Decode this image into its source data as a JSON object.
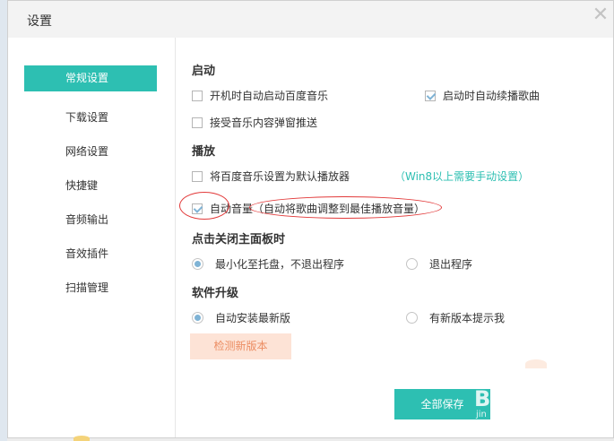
{
  "dialog": {
    "title": "设置",
    "close_glyph": "✕"
  },
  "nav": {
    "items": [
      {
        "label": "常规设置",
        "active": true
      },
      {
        "label": "下载设置"
      },
      {
        "label": "网络设置"
      },
      {
        "label": "快捷键"
      },
      {
        "label": "音频输出"
      },
      {
        "label": "音效插件"
      },
      {
        "label": "扫描管理"
      }
    ]
  },
  "sections": {
    "startup": {
      "title": "启动",
      "auto_start": {
        "label": "开机时自动启动百度音乐",
        "checked": false
      },
      "auto_resume": {
        "label": "启动时自动续播歌曲",
        "checked": true
      },
      "accept_push": {
        "label": "接受音乐内容弹窗推送",
        "checked": false
      }
    },
    "playback": {
      "title": "播放",
      "default_player": {
        "label": "将百度音乐设置为默认播放器",
        "checked": false,
        "note": "（Win8以上需要手动设置）"
      },
      "auto_volume": {
        "label": "自动音量（自动将歌曲调整到最佳播放音量）",
        "checked": true
      }
    },
    "close_behavior": {
      "title": "点击关闭主面板时",
      "minimize": {
        "label": "最小化至托盘，不退出程序",
        "selected": true
      },
      "exit": {
        "label": "退出程序",
        "selected": false
      }
    },
    "upgrade": {
      "title": "软件升级",
      "auto_install": {
        "label": "自动安装最新版",
        "selected": true
      },
      "notify": {
        "label": "有新版本提示我",
        "selected": false
      },
      "check_button": "检测新版本"
    }
  },
  "footer": {
    "save_all": "全部保存"
  },
  "watermark": {
    "text": "B",
    "sub": "jin"
  },
  "colors": {
    "accent": "#2dbfb2",
    "annotation": "#e23a3a",
    "check_btn_bg": "#fde3d6",
    "check_btn_text": "#ec8d62"
  }
}
